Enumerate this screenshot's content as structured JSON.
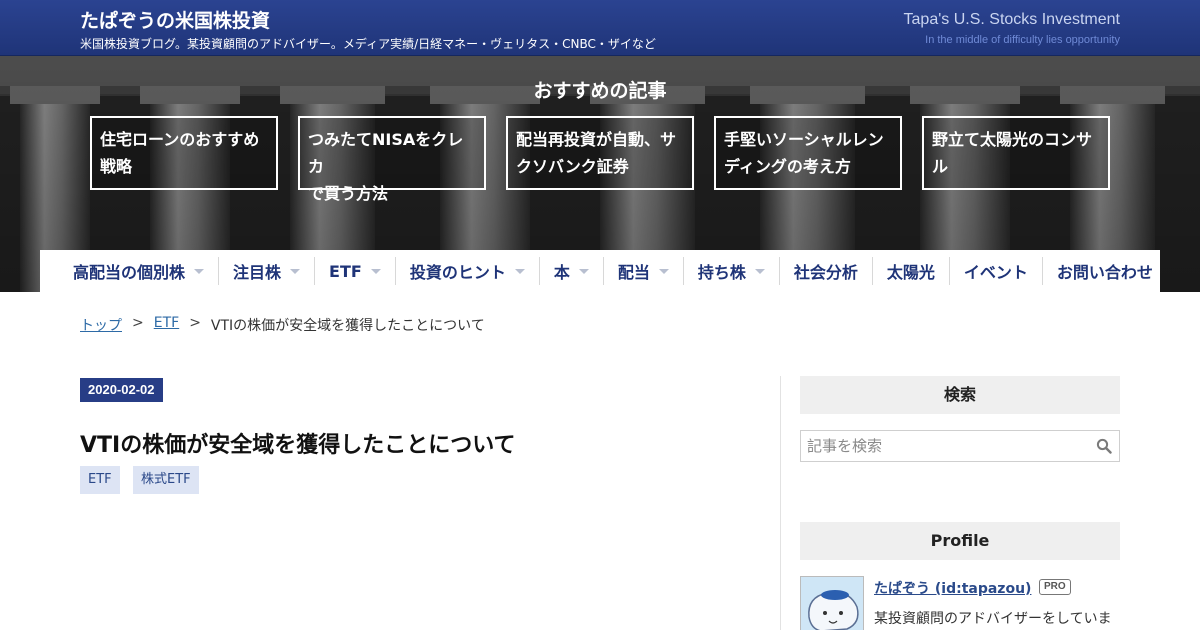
{
  "header": {
    "site_title": "たぱぞうの米国株投資",
    "site_description": "米国株投資ブログ。某投資顧問のアドバイザー。メディア実績/日経マネー・ヴェリタス・CNBC・ザイなど",
    "site_title_en": "Tapa's U.S. Stocks Investment",
    "tagline": "In the middle of difficulty lies opportunity"
  },
  "recommended": {
    "heading": "おすすめの記事",
    "items": [
      {
        "line1": "住宅ローンのおすすめ",
        "line2": "戦略"
      },
      {
        "line1": "つみたてNISAをクレカ",
        "line2": "で買う方法"
      },
      {
        "line1": "配当再投資が自動、サ",
        "line2": "クソバンク証券"
      },
      {
        "line1": "手堅いソーシャルレン",
        "line2": "ディングの考え方"
      },
      {
        "line1": "野立て太陽光のコンサ",
        "line2": "ル"
      }
    ]
  },
  "nav": {
    "items": [
      {
        "label": "高配当の個別株"
      },
      {
        "label": "注目株"
      },
      {
        "label": "ETF"
      },
      {
        "label": "投資のヒント"
      },
      {
        "label": "本"
      },
      {
        "label": "配当"
      },
      {
        "label": "持ち株"
      },
      {
        "label": "社会分析"
      },
      {
        "label": "太陽光"
      },
      {
        "label": "イベント"
      },
      {
        "label": "お問い合わせ"
      }
    ]
  },
  "breadcrumb": {
    "top": "トップ",
    "category": "ETF",
    "separator": ">",
    "current": "VTIの株価が安全域を獲得したことについて"
  },
  "article": {
    "date": "2020-02-02",
    "title": "VTIの株価が安全域を獲得したことについて",
    "categories": [
      "ETF",
      "株式ETF"
    ]
  },
  "sidebar": {
    "search_heading": "検索",
    "search_placeholder": "記事を検索",
    "profile_heading": "Profile",
    "profile_name": "たぱぞう (id:tapazou)",
    "pro_badge": "PRO",
    "profile_desc": "某投資顧問のアドバイザーをしていま"
  },
  "colors": {
    "header_bg": "#233a82",
    "accent": "#273d86",
    "nav_text": "#1f3478",
    "tag_bg": "#dde4f4"
  }
}
